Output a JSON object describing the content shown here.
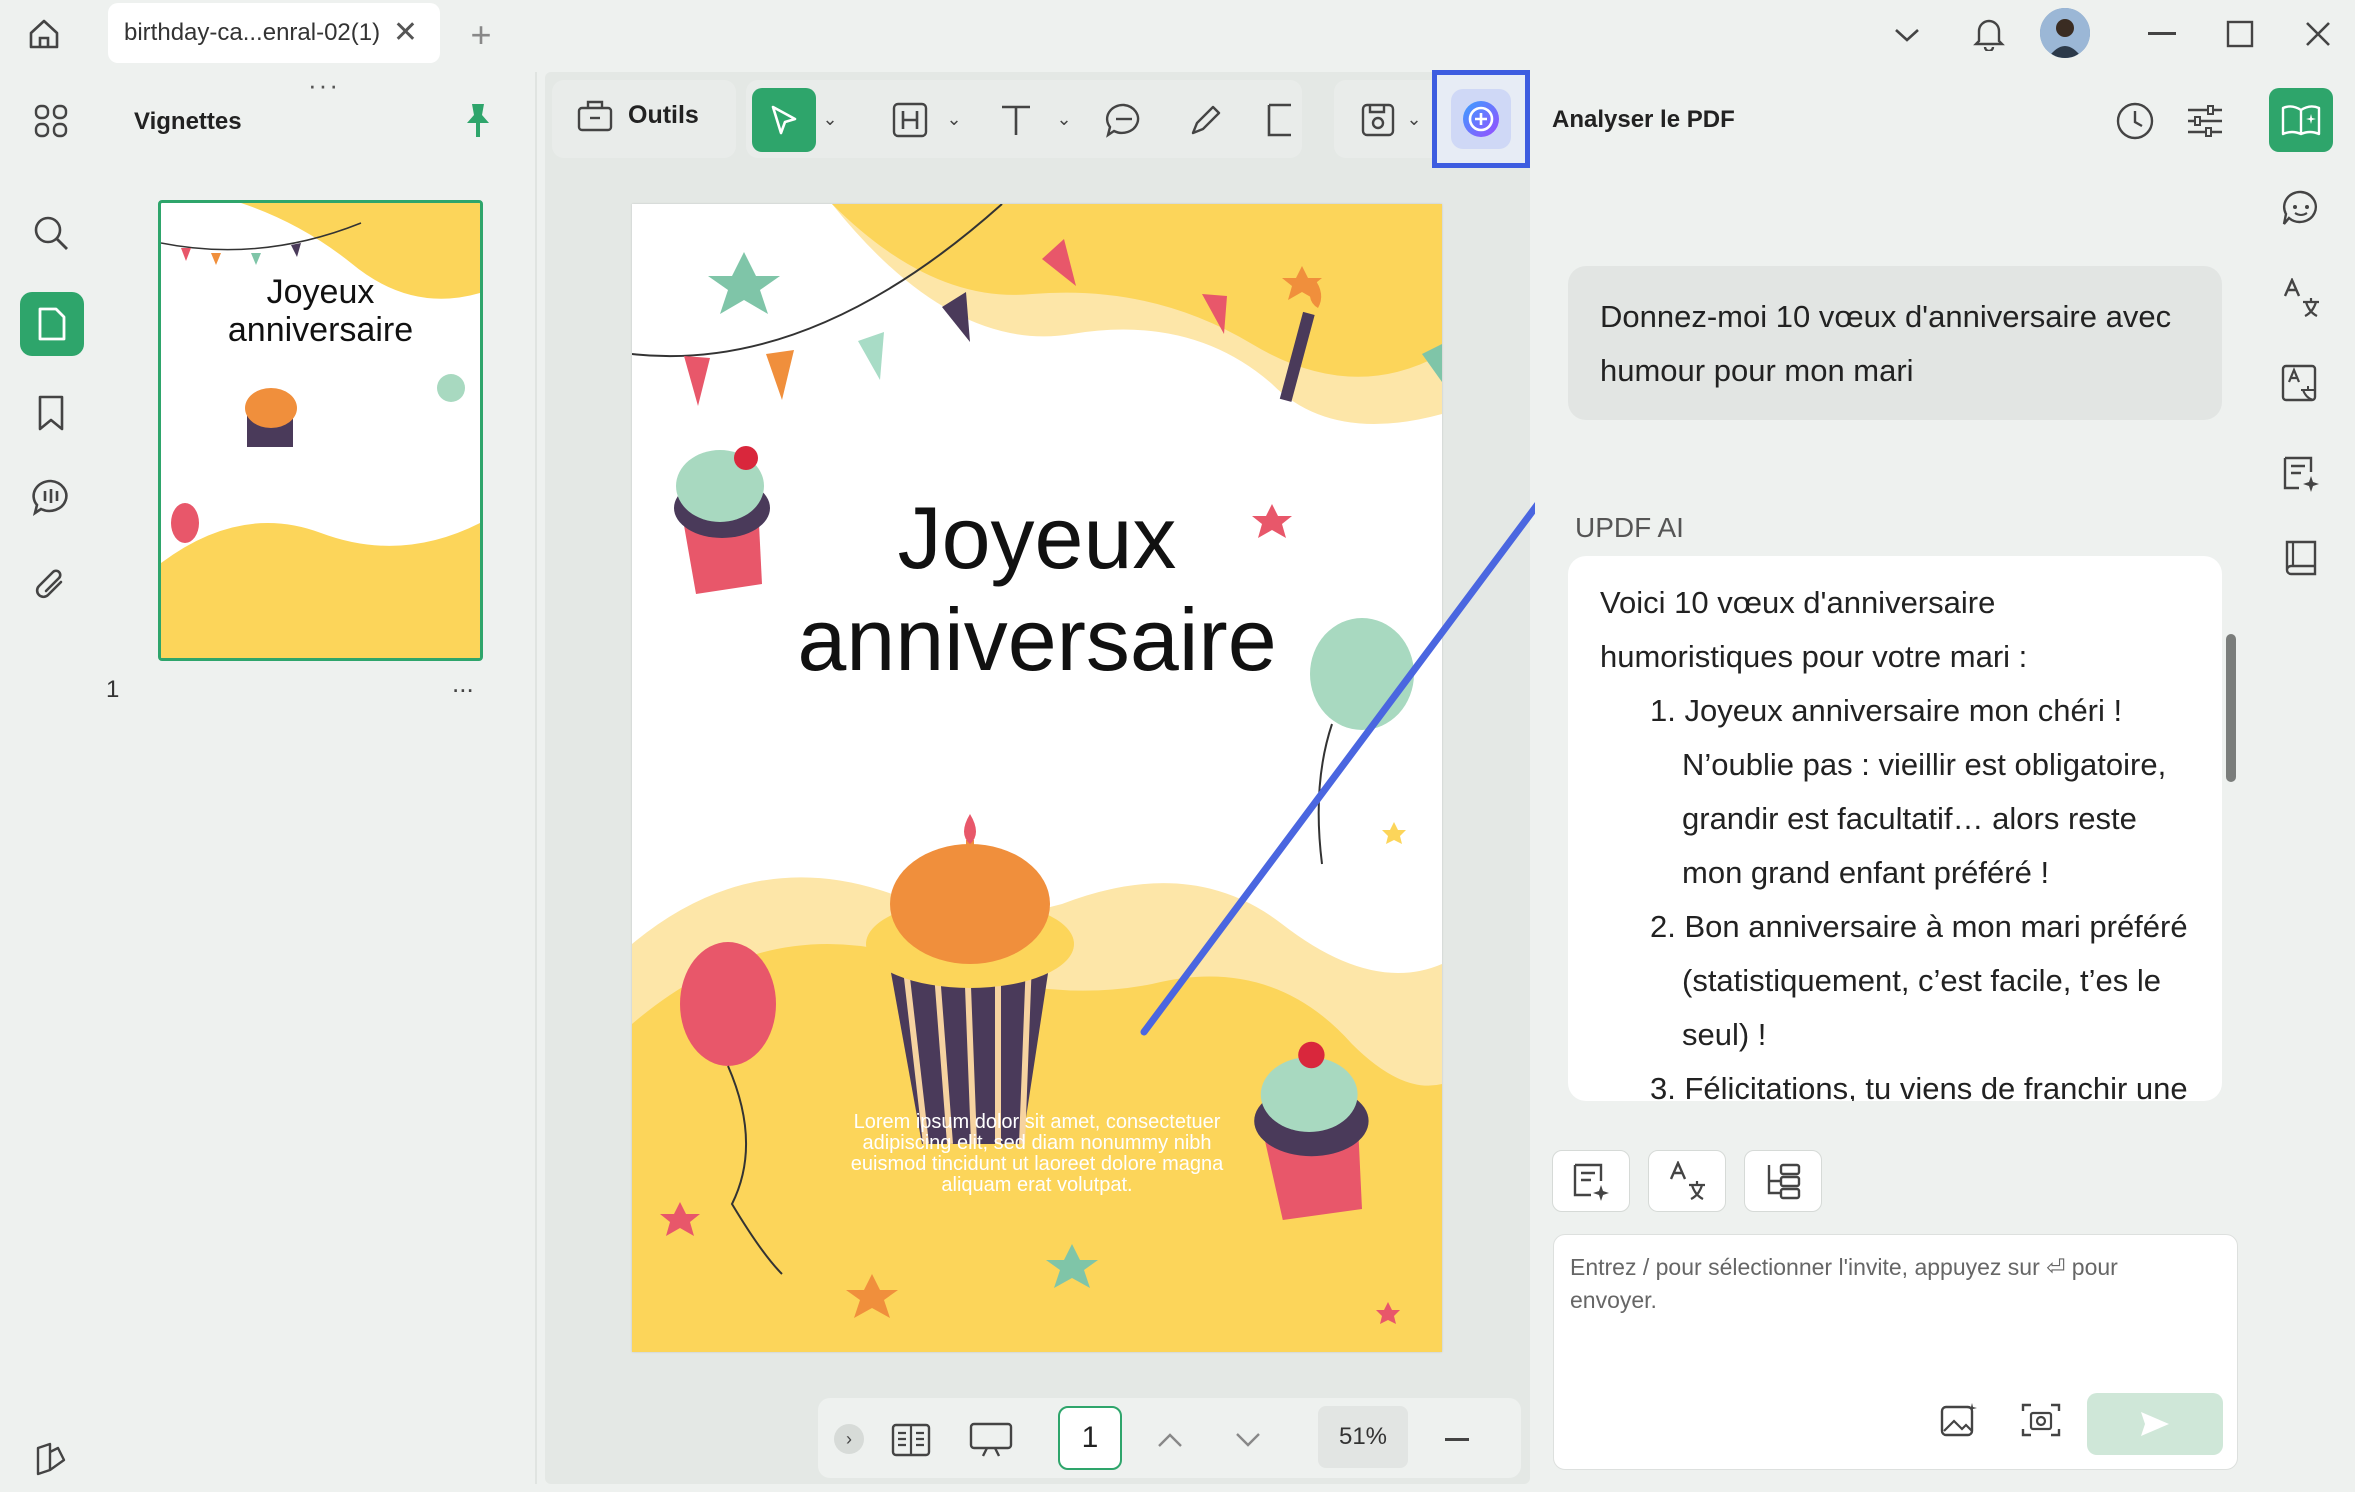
{
  "tabs": [
    {
      "label": "birthday-ca...enral-02(1)"
    }
  ],
  "thumbnails": {
    "title": "Vignettes",
    "page_number": "1",
    "more": "...",
    "thumb_title_line1": "Joyeux",
    "thumb_title_line2": "anniversaire"
  },
  "toolbar": {
    "tools_label": "Outils"
  },
  "document": {
    "title_line1": "Joyeux",
    "title_line2": "anniversaire",
    "body_text": "Lorem ipsum dolor sit amet, consectetuer adipiscing elit, sed diam nonummy nibh euismod tincidunt ut laoreet dolore magna aliquam erat volutpat."
  },
  "navigation": {
    "current_page": "1",
    "zoom": "51%"
  },
  "ai_panel": {
    "title": "Analyser le PDF",
    "user_message": "Donnez-moi 10 vœux d'anniversaire avec humour pour mon mari",
    "assistant_name": "UPDF AI",
    "assistant_intro": "Voici 10 vœux d'anniversaire humoristiques pour votre mari :",
    "assistant_items": [
      "1. Joyeux anniversaire mon chéri ! N’oublie pas : vieillir est obligatoire, grandir est facultatif… alors reste mon grand enfant préféré !",
      "2. Bon anniversaire à mon mari préféré (statistiquement, c’est facile, t’es le seul) !",
      "3. Félicitations, tu viens de franchir une"
    ],
    "input_placeholder": "Entrez / pour sélectionner l'invite, appuyez sur ⏎ pour envoyer."
  },
  "colors": {
    "accent": "#2ea56b",
    "highlight": "#3d5ce0",
    "arrow": "#4a66e0",
    "page_yellow": "#fcd55a"
  },
  "icons": [
    "home-icon",
    "bell-icon",
    "chevron-down-icon",
    "minimize-icon",
    "maximize-icon",
    "close-icon",
    "grid-icon",
    "search-icon",
    "page-icon",
    "bookmark-icon",
    "comment-icon",
    "attachment-icon",
    "pin-icon",
    "ai-assistant-icon",
    "history-icon",
    "settings-icon"
  ]
}
